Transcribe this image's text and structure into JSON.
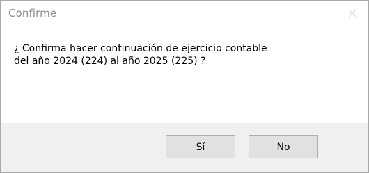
{
  "window": {
    "title": "Confirme",
    "close_icon": "close-icon"
  },
  "message": {
    "line1": "¿ Confirma hacer continuación de ejercicio contable",
    "line2": "del año 2024 (224) al año 2025 (225) ?"
  },
  "buttons": {
    "yes_label": "Sí",
    "no_label": "No"
  },
  "colors": {
    "title_text": "#8e8e8e",
    "button_bar_bg": "#f0f0f0",
    "button_bg": "#e1e1e1",
    "button_border": "#adadad",
    "close_icon": "#d4d4d4"
  }
}
